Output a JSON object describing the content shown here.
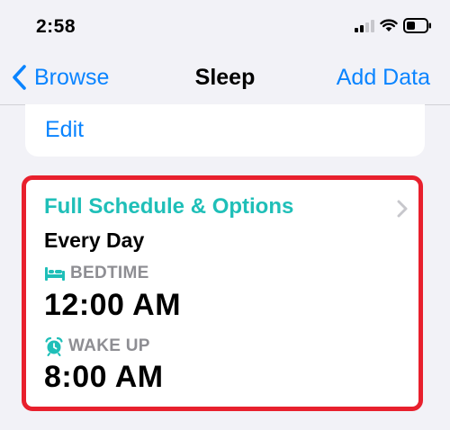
{
  "status_bar": {
    "time": "2:58"
  },
  "nav": {
    "back_label": "Browse",
    "title": "Sleep",
    "action_label": "Add Data"
  },
  "edit_card": {
    "edit_label": "Edit"
  },
  "schedule": {
    "title": "Full Schedule & Options",
    "frequency": "Every Day",
    "bedtime_label": "BEDTIME",
    "bedtime_value": "12:00 AM",
    "wakeup_label": "WAKE UP",
    "wakeup_value": "8:00 AM"
  },
  "icons": {
    "back": "chevron-left-icon",
    "disclosure": "chevron-right-icon",
    "bedtime": "bed-icon",
    "wakeup": "alarm-clock-icon",
    "signal": "cellular-signal-icon",
    "wifi": "wifi-icon",
    "battery": "battery-icon"
  },
  "colors": {
    "accent_blue": "#0a84ff",
    "sleep_teal": "#1fbfb8",
    "highlight_red": "#e8202d",
    "secondary_gray": "#8e8e93",
    "background": "#f2f2f7"
  }
}
